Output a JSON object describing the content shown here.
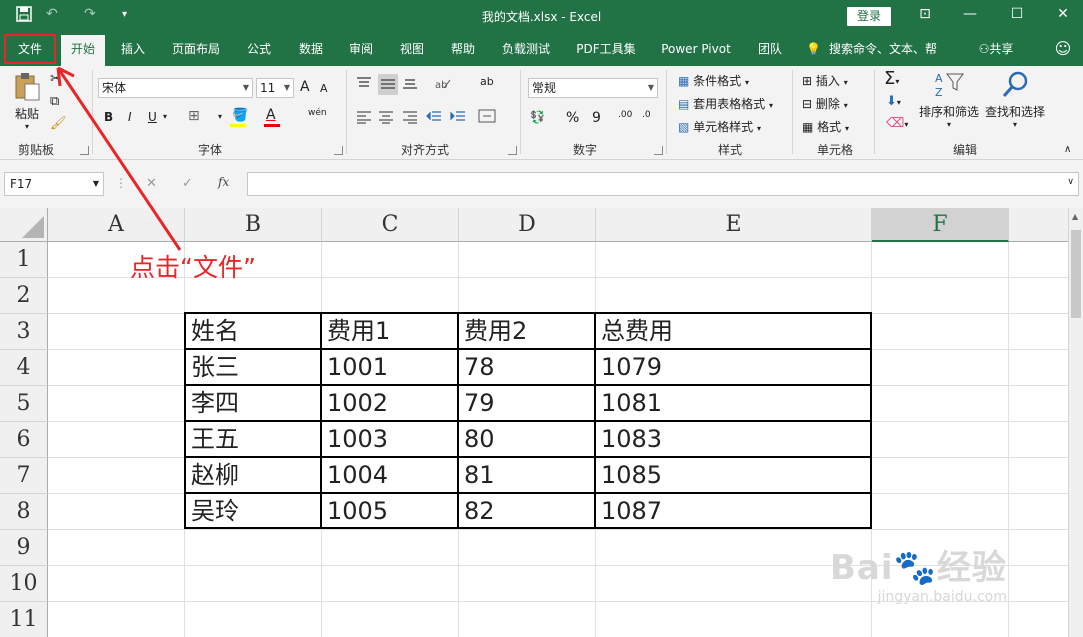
{
  "window": {
    "title": "我的文档.xlsx  -  Excel",
    "login_label": "登录",
    "minimize": "—",
    "restore": "☐",
    "close": "✕",
    "ribbon_display": "⊡"
  },
  "quick_access": {
    "save": "💾",
    "undo": "↶",
    "redo": "↷",
    "customize": "▾"
  },
  "tabs": [
    "文件",
    "开始",
    "插入",
    "页面布局",
    "公式",
    "数据",
    "审阅",
    "视图",
    "帮助",
    "负载测试",
    "PDF工具集",
    "Power Pivot",
    "团队"
  ],
  "tell_me": "搜索命令、文本、帮",
  "share": "共享",
  "ribbon": {
    "clipboard": {
      "label": "剪贴板",
      "paste": "粘贴"
    },
    "font": {
      "label": "字体",
      "name": "宋体",
      "size": "11",
      "bold": "B",
      "italic": "I",
      "underline": "U",
      "grow": "A",
      "shrink": "A",
      "pinyin": "wén"
    },
    "alignment": {
      "label": "对齐方式",
      "wrap": "ab"
    },
    "number": {
      "label": "数字",
      "format": "常规",
      "percent": "%",
      "comma": "9"
    },
    "styles": {
      "label": "样式",
      "conditional": "条件格式",
      "table": "套用表格格式",
      "cell": "单元格样式"
    },
    "cells": {
      "label": "单元格",
      "insert": "插入",
      "delete": "删除",
      "format": "格式"
    },
    "editing": {
      "label": "编辑",
      "sum": "Σ",
      "sort_filter": "排序和筛选",
      "find_select": "查找和选择"
    }
  },
  "formula_bar": {
    "name_box": "F17",
    "cancel": "✕",
    "enter": "✓",
    "fx": "fx",
    "value": ""
  },
  "columns": [
    "A",
    "B",
    "C",
    "D",
    "E",
    "F"
  ],
  "rows": [
    "1",
    "2",
    "3",
    "4",
    "5",
    "6",
    "7",
    "8",
    "9",
    "10",
    "11"
  ],
  "table": {
    "headers": [
      "姓名",
      "费用1",
      "费用2",
      "总费用"
    ],
    "rows": [
      [
        "张三",
        "1001",
        "78",
        "1079"
      ],
      [
        "李四",
        "1002",
        "79",
        "1081"
      ],
      [
        "王五",
        "1003",
        "80",
        "1083"
      ],
      [
        "赵柳",
        "1004",
        "81",
        "1085"
      ],
      [
        "吴玲",
        "1005",
        "82",
        "1087"
      ]
    ]
  },
  "annotation": "点击“文件”",
  "watermark": {
    "brand": "Bai🐾经验",
    "url": "jingyan.baidu.com"
  },
  "colors": {
    "brand": "#217346",
    "annotation": "#e8262a"
  }
}
